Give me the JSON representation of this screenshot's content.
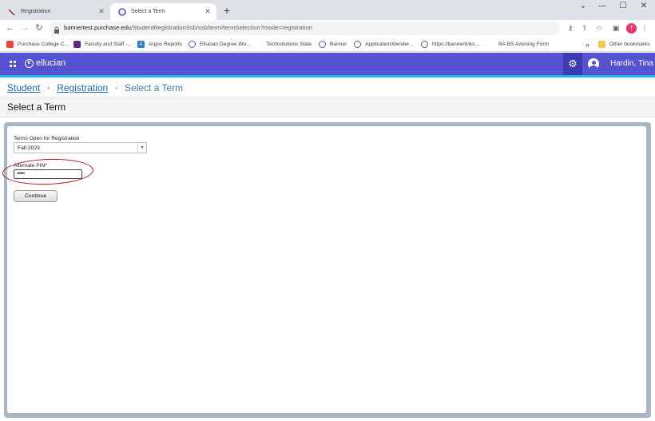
{
  "browser": {
    "tabs": [
      {
        "title": "Registration",
        "active": false
      },
      {
        "title": "Select a Term",
        "active": true
      }
    ],
    "url_host": "bannertest.purchase.edu",
    "url_path": "/StudentRegistrationSsb/ssb/term/termSelection?mode=registration",
    "profile_initial": "T",
    "bookmarks": [
      {
        "label": "Purchase College C...",
        "icon": "purchase-icon",
        "color": "#e8453c"
      },
      {
        "label": "Faculty and Staff -...",
        "icon": "bookmark-flag-icon",
        "color": "#5b2a86"
      },
      {
        "label": "Argos Reports",
        "icon": "argos-icon",
        "color": "#2a7fc1"
      },
      {
        "label": "Ellucian Degree Wo...",
        "icon": "ellucian-icon",
        "color": "#5353d1"
      },
      {
        "label": "Technolutions Slate",
        "icon": "",
        "color": ""
      },
      {
        "label": "Banner",
        "icon": "ellucian-icon",
        "color": "#5353d1"
      },
      {
        "label": "ApplicationXtender...",
        "icon": "globe-icon",
        "color": "#5f6368"
      },
      {
        "label": "https://bannerlinks....",
        "icon": "globe-icon",
        "color": "#5f6368"
      },
      {
        "label": "BA.BS Advising Form",
        "icon": "",
        "color": ""
      }
    ],
    "overflow": "»",
    "other_bookmarks": "Other bookmarks"
  },
  "app": {
    "brand": "ellucian",
    "user_name": "Hardin, Tina",
    "accent": "#5353d1"
  },
  "breadcrumb": {
    "student": "Student",
    "registration": "Registration",
    "current": "Select a Term",
    "separator": "•"
  },
  "page": {
    "title": "Select a Term"
  },
  "form": {
    "terms_label": "Terms Open for Registration",
    "term_value": "Fall 2023",
    "pin_label": "Alternate PIN*",
    "pin_value": "••••••",
    "continue_label": "Continue"
  }
}
